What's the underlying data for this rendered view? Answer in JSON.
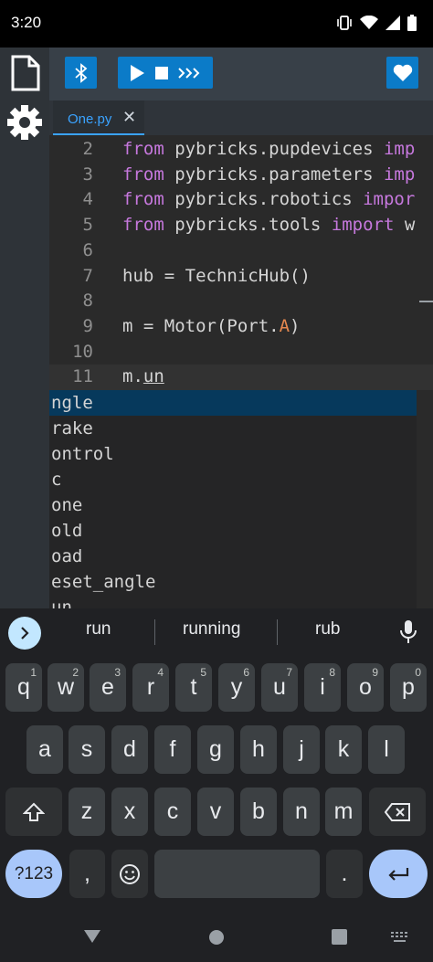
{
  "status_bar": {
    "time": "3:20"
  },
  "tabs": [
    {
      "label": "One.py",
      "close": "✕"
    }
  ],
  "editor": {
    "lines": [
      {
        "num": "2",
        "parts": [
          {
            "t": "from",
            "c": "kw"
          },
          {
            "t": " pybricks.pupdevices "
          },
          {
            "t": "imp",
            "c": "kw"
          }
        ]
      },
      {
        "num": "3",
        "parts": [
          {
            "t": "from",
            "c": "kw"
          },
          {
            "t": " pybricks.parameters "
          },
          {
            "t": "imp",
            "c": "kw"
          }
        ]
      },
      {
        "num": "4",
        "parts": [
          {
            "t": "from",
            "c": "kw"
          },
          {
            "t": " pybricks.robotics "
          },
          {
            "t": "impor",
            "c": "kw"
          }
        ]
      },
      {
        "num": "5",
        "parts": [
          {
            "t": "from",
            "c": "kw"
          },
          {
            "t": " pybricks.tools "
          },
          {
            "t": "import",
            "c": "kw"
          },
          {
            "t": " w"
          }
        ]
      },
      {
        "num": "6",
        "parts": []
      },
      {
        "num": "7",
        "parts": [
          {
            "t": "hub = TechnicHub()"
          }
        ]
      },
      {
        "num": "8",
        "parts": []
      },
      {
        "num": "9",
        "parts": [
          {
            "t": "m = Motor(Port."
          },
          {
            "t": "A",
            "c": "str"
          },
          {
            "t": ")"
          }
        ]
      },
      {
        "num": "10",
        "parts": []
      },
      {
        "num": "11",
        "parts": [
          {
            "t": "m."
          },
          {
            "t": "un",
            "c": "u"
          }
        ]
      }
    ]
  },
  "autocomplete": {
    "items": [
      "ngle",
      "rake",
      "ontrol",
      "c",
      "one",
      "old",
      "oad",
      "eset_angle",
      "un"
    ],
    "selected_index": 0
  },
  "keyboard": {
    "suggestions": [
      "run",
      "running",
      "rub"
    ],
    "row1": [
      {
        "k": "q",
        "s": "1"
      },
      {
        "k": "w",
        "s": "2"
      },
      {
        "k": "e",
        "s": "3"
      },
      {
        "k": "r",
        "s": "4"
      },
      {
        "k": "t",
        "s": "5"
      },
      {
        "k": "y",
        "s": "6"
      },
      {
        "k": "u",
        "s": "7"
      },
      {
        "k": "i",
        "s": "8"
      },
      {
        "k": "o",
        "s": "9"
      },
      {
        "k": "p",
        "s": "0"
      }
    ],
    "row2": [
      "a",
      "s",
      "d",
      "f",
      "g",
      "h",
      "j",
      "k",
      "l"
    ],
    "row3": [
      "z",
      "x",
      "c",
      "v",
      "b",
      "n",
      "m"
    ],
    "symbols": "?123",
    "comma": ",",
    "period": "."
  },
  "colors": {
    "accent": "#0b7bc8",
    "tab_active": "#3aa3ff",
    "selection": "#06395c"
  }
}
